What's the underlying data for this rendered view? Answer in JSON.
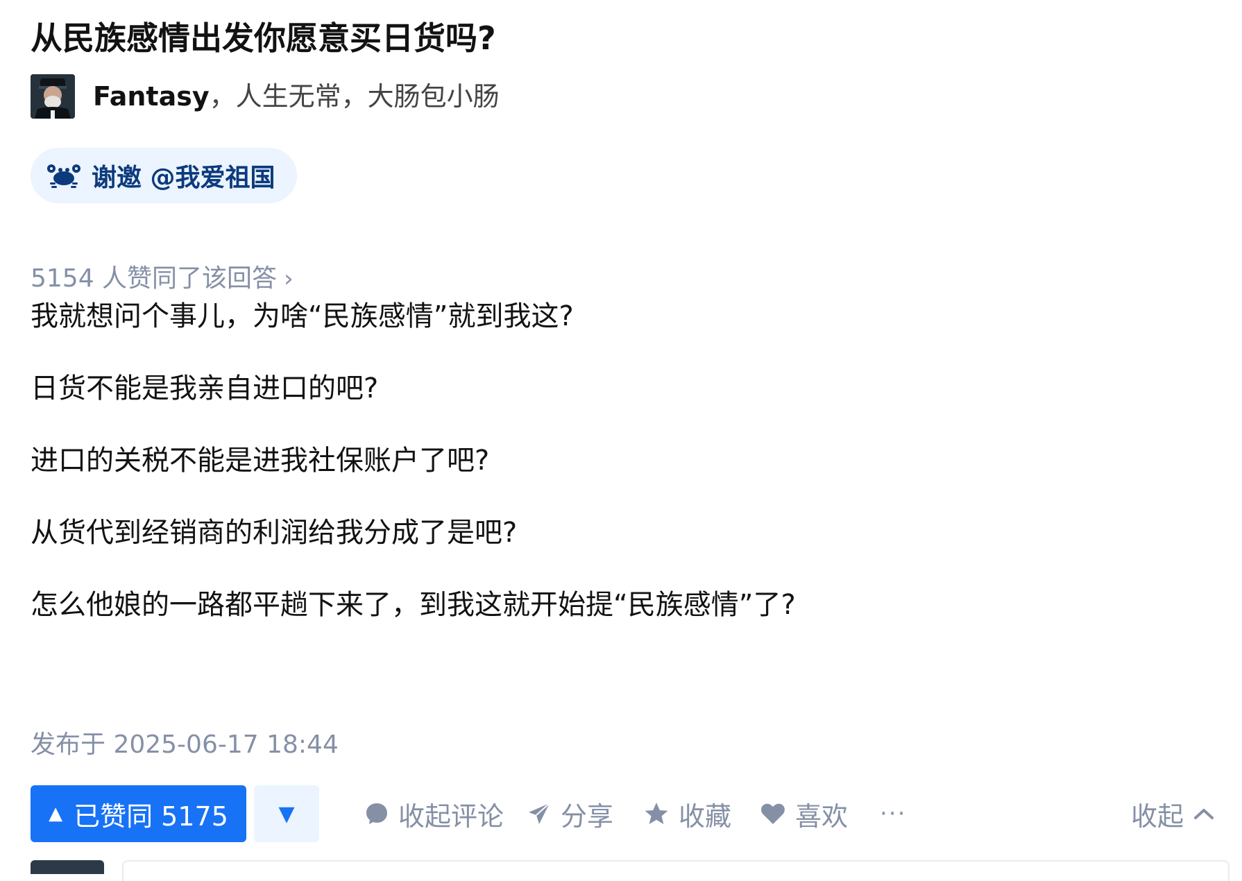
{
  "question": {
    "title": "从民族感情出发你愿意买日货吗?"
  },
  "author": {
    "name": "Fantasy",
    "separator": "，",
    "bio": "人生无常，大肠包小肠",
    "avatar_icon": "person-avatar"
  },
  "invite": {
    "label": "谢邀 @我爱祖国",
    "icon": "crab-icon",
    "text_color": "#0c3a7d",
    "bg_color": "#ebf4ff"
  },
  "upvote_summary": {
    "text": "5154 人赞同了该回答",
    "chevron": "›"
  },
  "answer": {
    "paragraphs": [
      "我就想问个事儿，为啥“民族感情”就到我这?",
      "日货不能是我亲自进口的吧?",
      "进口的关税不能是进我社保账户了吧?",
      "从货代到经销商的利润给我分成了是吧?",
      "怎么他娘的一路都平趟下来了，到我这就开始提“民族感情”了?"
    ],
    "publish_time": "发布于 2025-06-17 18:44"
  },
  "actions": {
    "upvote_label": "已赞同 5175",
    "upvote_arrow": "▲",
    "downvote_arrow": "▼",
    "comment_label": "收起评论",
    "share_label": "分享",
    "favorite_label": "收藏",
    "like_label": "喜欢",
    "more_label": "···",
    "collapse_label": "收起",
    "accent_color": "#1772f6",
    "muted_color": "#8590a6"
  }
}
